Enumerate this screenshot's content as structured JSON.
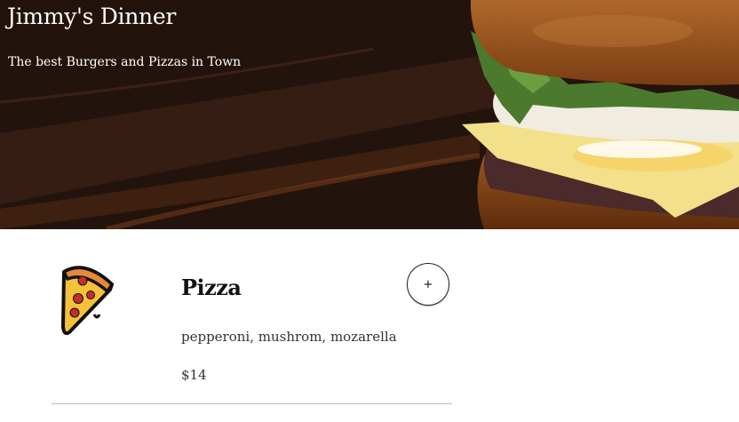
{
  "header": {
    "title": "Jimmy's Dinner",
    "subtitle": "The best Burgers and Pizzas in Town"
  },
  "menu": {
    "items": [
      {
        "icon": "pizza-slice-icon",
        "name": "Pizza",
        "ingredients": "pepperoni, mushrom, mozarella",
        "price": "$14",
        "add_label": "+"
      }
    ]
  },
  "colors": {
    "hero_dark": "#2c1811",
    "text_light": "#ffffff",
    "divider": "#bdbdbd"
  }
}
